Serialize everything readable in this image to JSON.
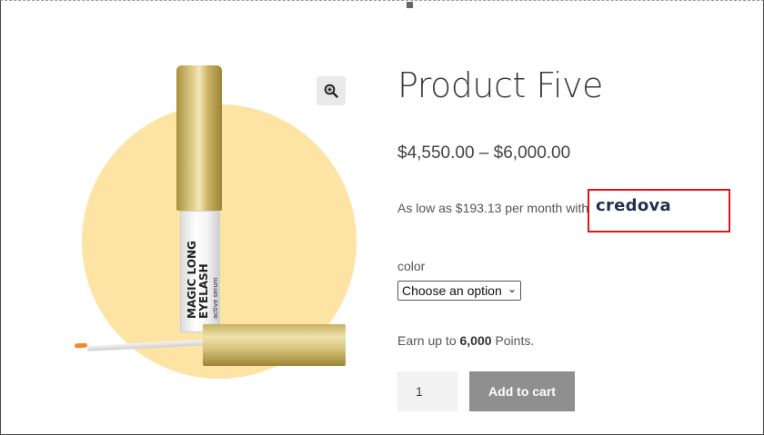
{
  "product": {
    "title": "Product Five",
    "price_range": "$4,550.00 – $6,000.00",
    "financing": {
      "prefix": "As low as $193.13 per month with",
      "brand": "credova"
    },
    "image": {
      "tube_line1": "MAGIC LONG",
      "tube_line2": "EYELASH",
      "tube_line3": "active serum"
    }
  },
  "variation": {
    "label": "color",
    "selected": "Choose an option"
  },
  "points": {
    "prefix": "Earn up to",
    "amount": "6,000",
    "suffix": "Points."
  },
  "cart": {
    "quantity": "1",
    "add_label": "Add to cart"
  },
  "icons": {
    "zoom": "zoom-in-icon",
    "select": "chevron-down-icon"
  },
  "colors": {
    "accent_circle": "#fde3a4",
    "highlight_box": "#e0141b",
    "button": "#8f8f8f"
  }
}
